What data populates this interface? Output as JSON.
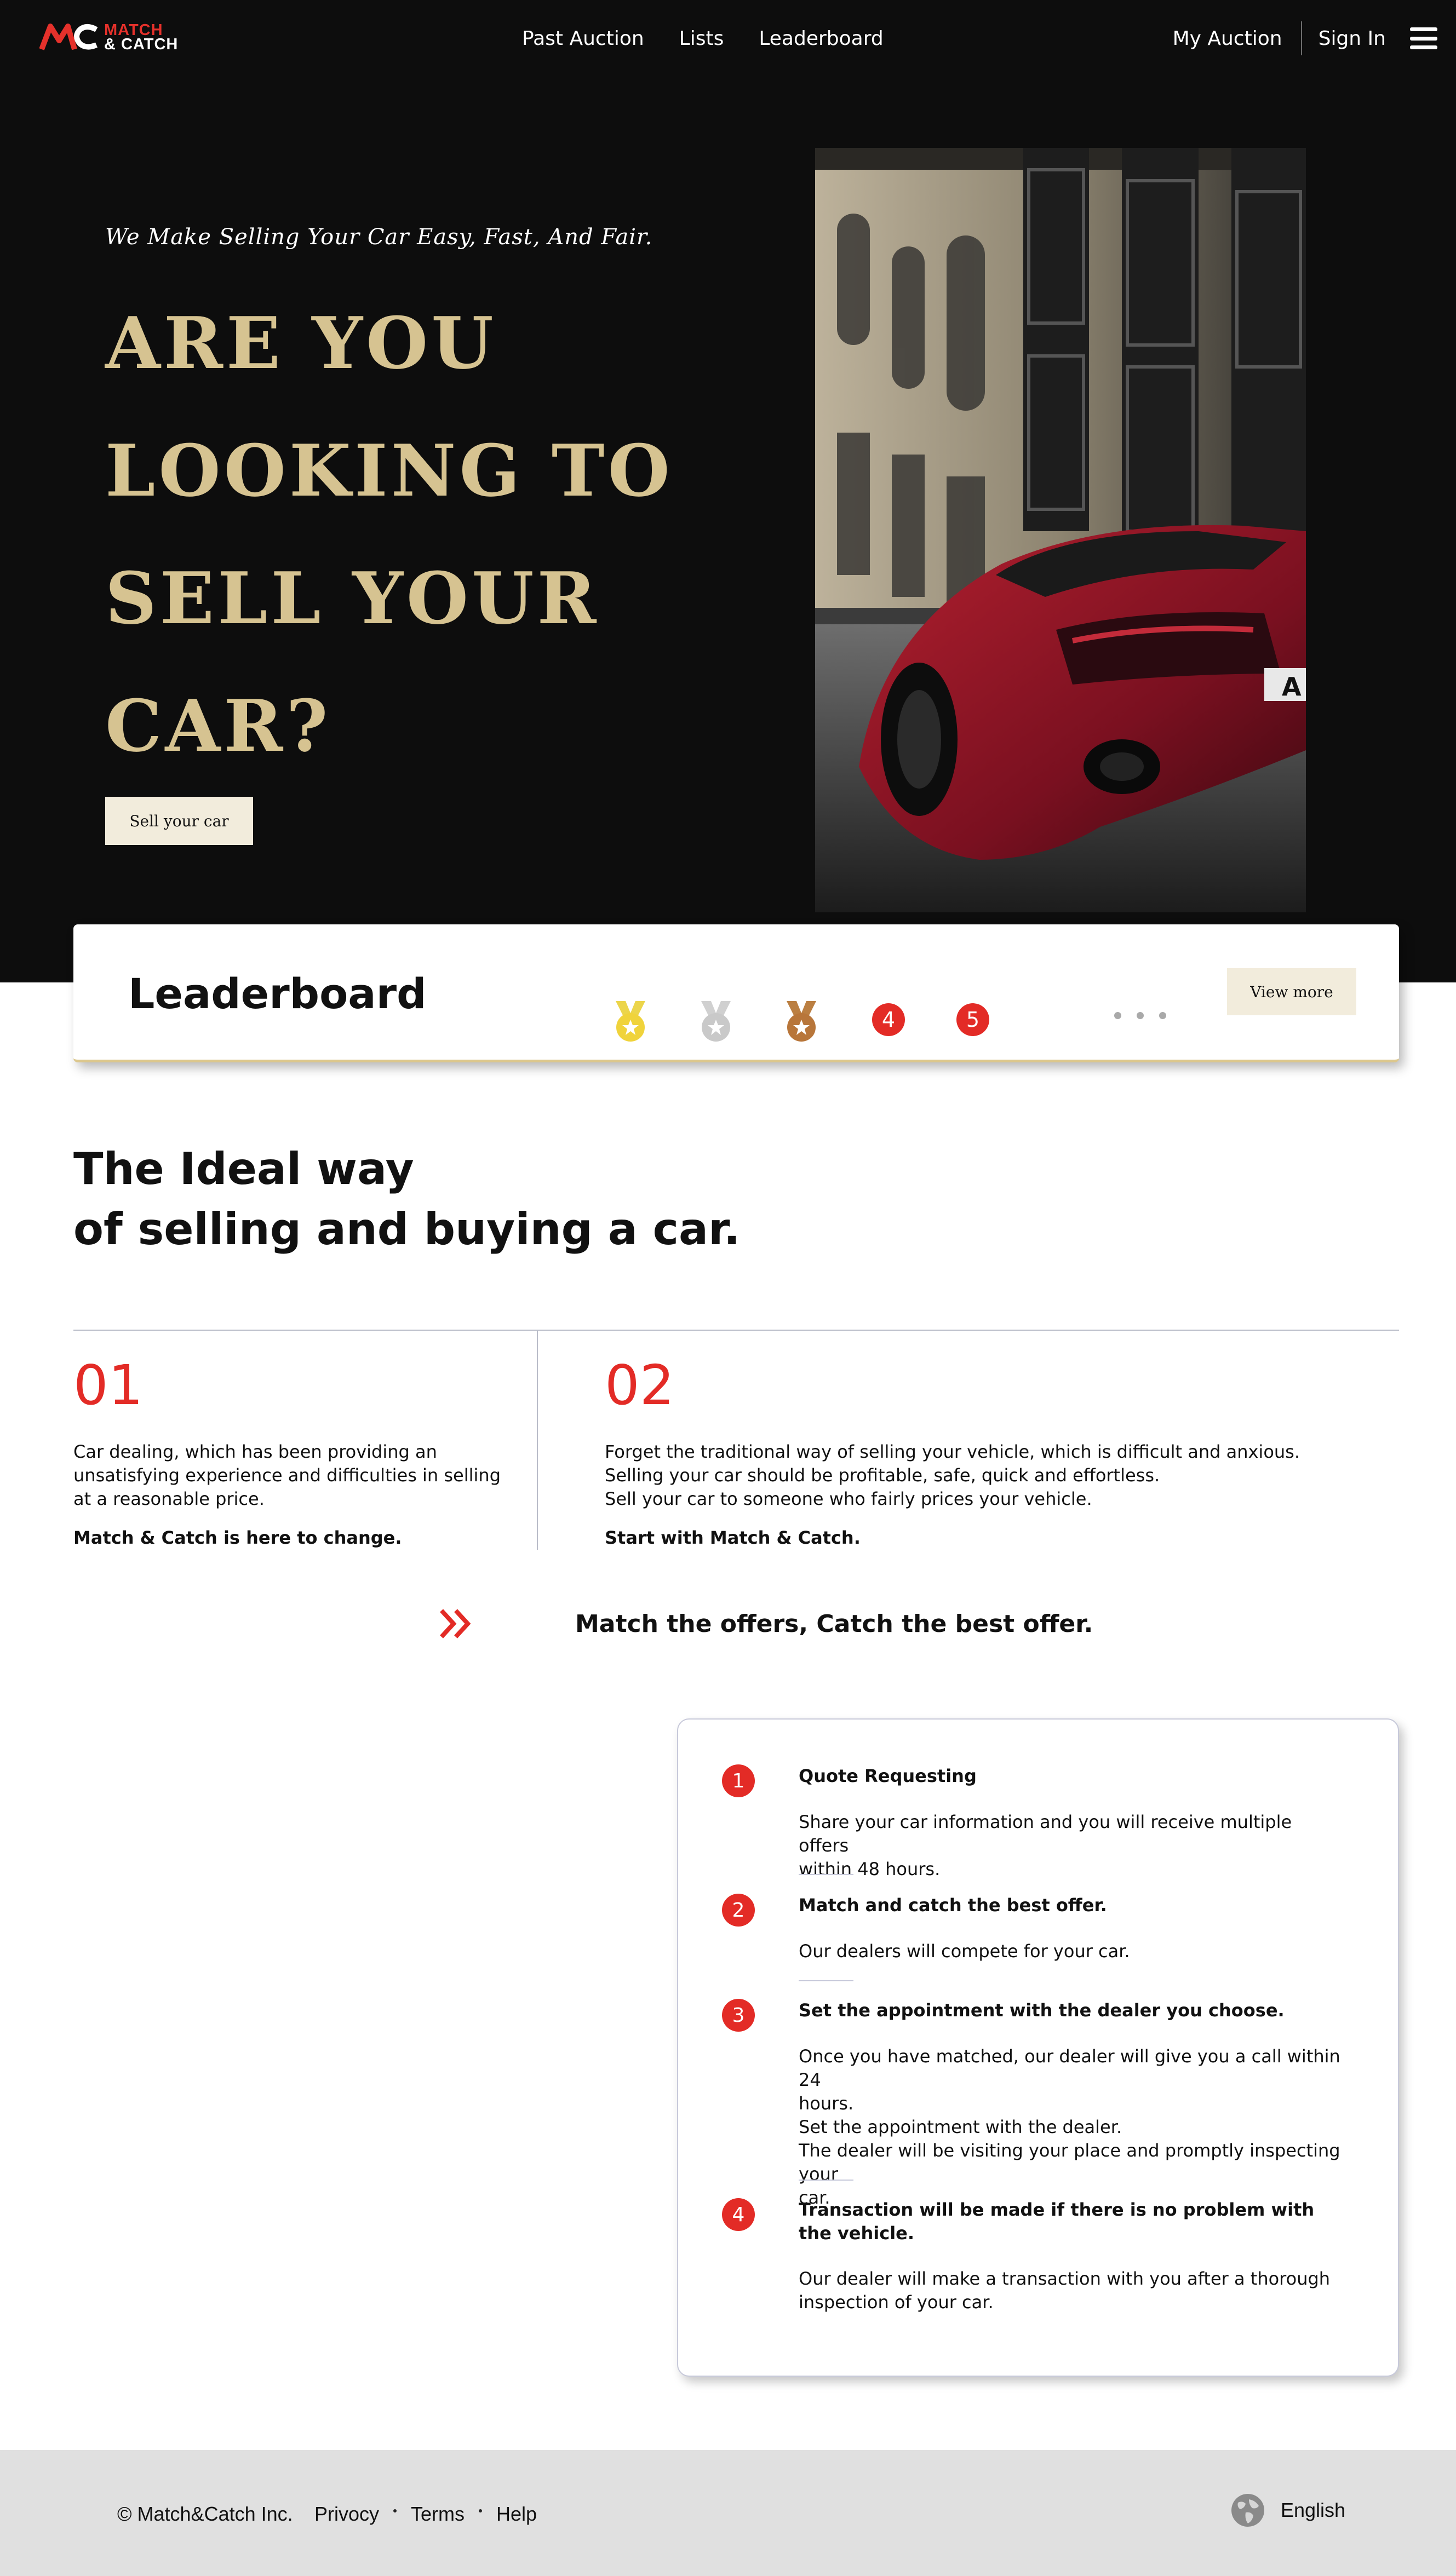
{
  "nav": {
    "logo_line1": "MATCH",
    "logo_line2": "& CATCH",
    "links": [
      "Past Auction",
      "Lists",
      "Leaderboard"
    ],
    "my_auction": "My Auction",
    "sign_in": "Sign In"
  },
  "hero": {
    "subtitle": "We Make Selling Your Car Easy, Fast, And Fair.",
    "title_lines": [
      "ARE YOU",
      "LOOKING TO",
      "SELL YOUR",
      "CAR?"
    ],
    "cta": "Sell your car",
    "plate": "A"
  },
  "leaderboard": {
    "title": "Leaderboard",
    "medals": [
      "gold-medal-icon",
      "silver-medal-icon",
      "bronze-medal-icon"
    ],
    "ranks": [
      "4",
      "5"
    ],
    "view_more": "View more"
  },
  "ideal": {
    "title_lines": [
      "The Ideal way",
      "of selling and buying a car."
    ],
    "col1": {
      "num": "01",
      "lines": [
        "Car dealing, which has been providing an",
        "unsatisfying experience and difficulties in selling",
        "at a reasonable price."
      ],
      "strong": "Match & Catch is here to change."
    },
    "col2": {
      "num": "02",
      "lines": [
        "Forget the traditional way of selling your vehicle, which is difficult and anxious.",
        "Selling your car should be profitable, safe, quick and effortless.",
        "Sell your car to someone who fairly prices your vehicle."
      ],
      "strong": "Start with Match & Catch."
    }
  },
  "tagline": "Match the offers, Catch the best offer.",
  "steps": [
    {
      "num": "1",
      "title": "Quote Requesting",
      "desc": [
        "Share your car information and you will receive multiple offers",
        "within 48 hours."
      ]
    },
    {
      "num": "2",
      "title": "Match and catch the best offer.",
      "desc": [
        "Our dealers will compete for your car."
      ]
    },
    {
      "num": "3",
      "title": "Set the appointment with the dealer you choose.",
      "desc": [
        "Once you have matched, our dealer will give you a call within 24",
        "hours.",
        "Set the appointment with the dealer.",
        "The dealer will be visiting your place and promptly inspecting your",
        "car."
      ]
    },
    {
      "num": "4",
      "title": "Transaction will be made if there is no problem with the vehicle.",
      "desc": [
        "Our dealer will make a transaction with you after a thorough",
        "inspection of your car."
      ]
    }
  ],
  "footer": {
    "copyright": "© Match&Catch Inc.",
    "links": [
      "Privocy",
      "Terms",
      "Help"
    ],
    "language": "English"
  },
  "colors": {
    "brand_red": "#e32b26",
    "gold": "#d6c391",
    "cream_button": "#f2ecdc",
    "dark_bg": "#0d0d0d",
    "footer_bg": "#e0e0e0"
  }
}
